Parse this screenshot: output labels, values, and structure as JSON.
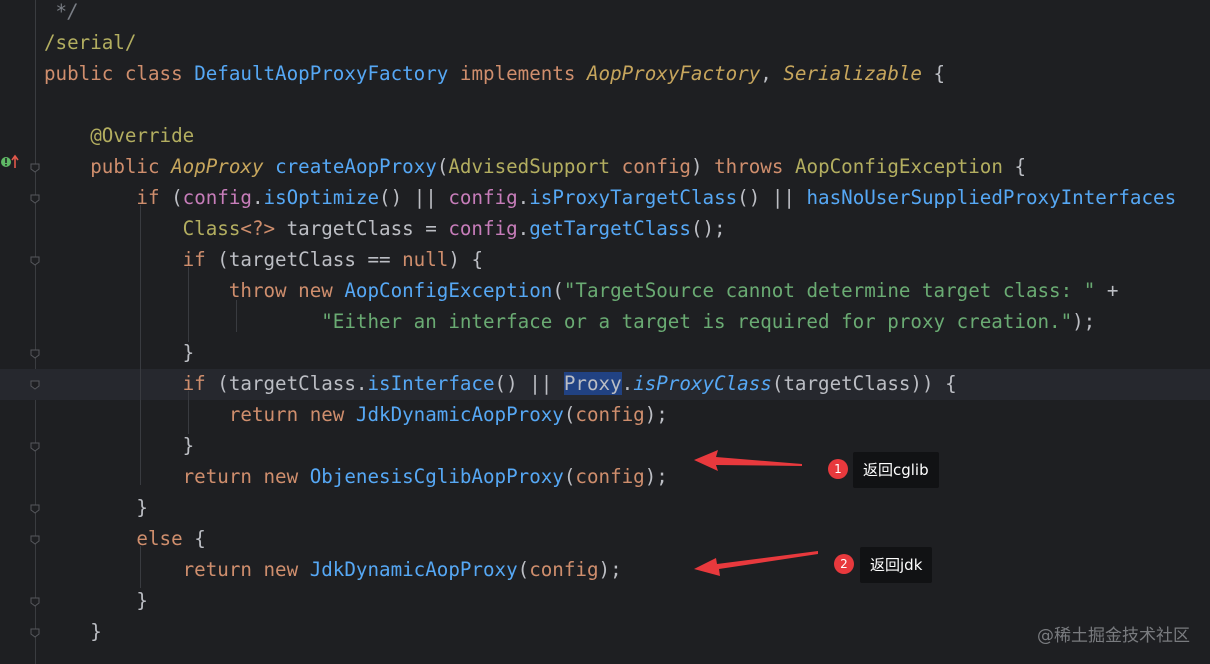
{
  "editor": {
    "lines": [
      {
        "id": "l0",
        "tokens": [
          {
            "t": "cm",
            "v": " */"
          }
        ]
      },
      {
        "id": "l1",
        "tokens": [
          {
            "t": "a",
            "v": "/serial/"
          }
        ]
      },
      {
        "id": "l2",
        "tokens": [
          {
            "t": "k",
            "v": "public class "
          },
          {
            "t": "ret-cls",
            "v": "DefaultAopProxyFactory"
          },
          {
            "t": "k",
            "v": " implements "
          },
          {
            "t": "itf",
            "v": "AopProxyFactory"
          },
          {
            "t": "c",
            "v": ", "
          },
          {
            "t": "itf",
            "v": "Serializable"
          },
          {
            "t": "c",
            "v": " {"
          }
        ]
      },
      {
        "id": "l3",
        "tokens": []
      },
      {
        "id": "l4",
        "tokens": [
          {
            "t": "c",
            "v": "    "
          },
          {
            "t": "a",
            "v": "@Override"
          }
        ]
      },
      {
        "id": "l5",
        "tokens": [
          {
            "t": "c",
            "v": "    "
          },
          {
            "t": "k",
            "v": "public "
          },
          {
            "t": "itf",
            "v": "AopProxy"
          },
          {
            "t": "c",
            "v": " "
          },
          {
            "t": "m",
            "v": "createAopProxy"
          },
          {
            "t": "c",
            "v": "("
          },
          {
            "t": "a",
            "v": "AdvisedSupport"
          },
          {
            "t": "c",
            "v": " "
          },
          {
            "t": "k",
            "v": "config"
          },
          {
            "t": "c",
            "v": ") "
          },
          {
            "t": "k",
            "v": "throws "
          },
          {
            "t": "a",
            "v": "AopConfigException"
          },
          {
            "t": "c",
            "v": " {"
          }
        ]
      },
      {
        "id": "l6",
        "tokens": [
          {
            "t": "c",
            "v": "        "
          },
          {
            "t": "k",
            "v": "if "
          },
          {
            "t": "c",
            "v": "("
          },
          {
            "t": "fld",
            "v": "config"
          },
          {
            "t": "c",
            "v": "."
          },
          {
            "t": "m",
            "v": "isOptimize"
          },
          {
            "t": "c",
            "v": "() || "
          },
          {
            "t": "fld",
            "v": "config"
          },
          {
            "t": "c",
            "v": "."
          },
          {
            "t": "m",
            "v": "isProxyTargetClass"
          },
          {
            "t": "c",
            "v": "() || "
          },
          {
            "t": "m",
            "v": "hasNoUserSuppliedProxyInterfaces"
          }
        ]
      },
      {
        "id": "l7",
        "tokens": [
          {
            "t": "c",
            "v": "            "
          },
          {
            "t": "a",
            "v": "Class"
          },
          {
            "t": "k",
            "v": "<?>"
          },
          {
            "t": "c",
            "v": " targetClass = "
          },
          {
            "t": "fld",
            "v": "config"
          },
          {
            "t": "c",
            "v": "."
          },
          {
            "t": "m",
            "v": "getTargetClass"
          },
          {
            "t": "c",
            "v": "();"
          }
        ]
      },
      {
        "id": "l8",
        "tokens": [
          {
            "t": "c",
            "v": "            "
          },
          {
            "t": "k",
            "v": "if "
          },
          {
            "t": "c",
            "v": "(targetClass == "
          },
          {
            "t": "k",
            "v": "null"
          },
          {
            "t": "c",
            "v": ") {"
          }
        ]
      },
      {
        "id": "l9",
        "tokens": [
          {
            "t": "c",
            "v": "                "
          },
          {
            "t": "k",
            "v": "throw new "
          },
          {
            "t": "m",
            "v": "AopConfigException"
          },
          {
            "t": "c",
            "v": "("
          },
          {
            "t": "st",
            "v": "\"TargetSource cannot determine target class: \""
          },
          {
            "t": "c",
            "v": " +"
          }
        ]
      },
      {
        "id": "l10",
        "tokens": [
          {
            "t": "c",
            "v": "                        "
          },
          {
            "t": "st",
            "v": "\"Either an interface or a target is required for proxy creation.\""
          },
          {
            "t": "c",
            "v": ");"
          }
        ]
      },
      {
        "id": "l11",
        "tokens": [
          {
            "t": "c",
            "v": "            }"
          }
        ]
      },
      {
        "id": "l12",
        "tokens": [
          {
            "t": "c",
            "v": "            "
          },
          {
            "t": "k",
            "v": "if "
          },
          {
            "t": "c",
            "v": "(targetClass."
          },
          {
            "t": "m",
            "v": "isInterface"
          },
          {
            "t": "c",
            "v": "() || "
          },
          {
            "t": "hl",
            "v": "Proxy"
          },
          {
            "t": "c",
            "v": "."
          },
          {
            "t": "sti",
            "v": "isProxyClass"
          },
          {
            "t": "c",
            "v": "(targetClass)) {"
          }
        ]
      },
      {
        "id": "l13",
        "tokens": [
          {
            "t": "c",
            "v": "                "
          },
          {
            "t": "k",
            "v": "return new "
          },
          {
            "t": "m",
            "v": "JdkDynamicAopProxy"
          },
          {
            "t": "c",
            "v": "("
          },
          {
            "t": "k",
            "v": "config"
          },
          {
            "t": "c",
            "v": ");"
          }
        ]
      },
      {
        "id": "l14",
        "tokens": [
          {
            "t": "c",
            "v": "            }"
          }
        ]
      },
      {
        "id": "l15",
        "tokens": [
          {
            "t": "c",
            "v": "            "
          },
          {
            "t": "k",
            "v": "return new "
          },
          {
            "t": "m",
            "v": "ObjenesisCglibAopProxy"
          },
          {
            "t": "c",
            "v": "("
          },
          {
            "t": "k",
            "v": "config"
          },
          {
            "t": "c",
            "v": ");"
          }
        ]
      },
      {
        "id": "l16",
        "tokens": [
          {
            "t": "c",
            "v": "        }"
          }
        ]
      },
      {
        "id": "l17",
        "tokens": [
          {
            "t": "c",
            "v": "        "
          },
          {
            "t": "k",
            "v": "else "
          },
          {
            "t": "c",
            "v": "{"
          }
        ]
      },
      {
        "id": "l18",
        "tokens": [
          {
            "t": "c",
            "v": "            "
          },
          {
            "t": "k",
            "v": "return new "
          },
          {
            "t": "m",
            "v": "JdkDynamicAopProxy"
          },
          {
            "t": "c",
            "v": "("
          },
          {
            "t": "k",
            "v": "config"
          },
          {
            "t": "c",
            "v": ");"
          }
        ]
      },
      {
        "id": "l19",
        "tokens": [
          {
            "t": "c",
            "v": "        }"
          }
        ]
      },
      {
        "id": "l20",
        "tokens": [
          {
            "t": "c",
            "v": "    }"
          }
        ]
      }
    ]
  },
  "annotations": {
    "a1": {
      "number": "1",
      "text": "返回cglib"
    },
    "a2": {
      "number": "2",
      "text": "返回jdk"
    }
  },
  "watermark": "@稀土掘金技术社区",
  "colors": {
    "background": "#1e1f22",
    "keyword": "#cf8e6d",
    "method": "#56a8f5",
    "string": "#6aab73",
    "field": "#c77dba",
    "annotation_badge": "#e8393d"
  }
}
